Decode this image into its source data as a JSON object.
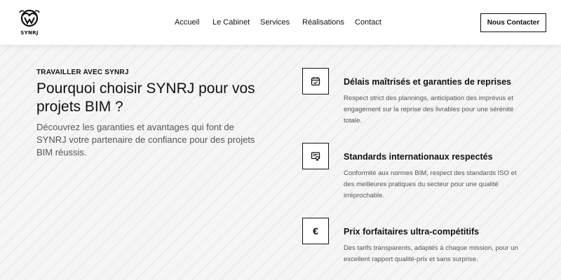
{
  "header": {
    "logo_text": "SYNRJ",
    "nav": [
      "Accueil",
      "Le Cabinet",
      "Services",
      "Réalisations",
      "Contact"
    ],
    "cta_label": "Nous Contacter"
  },
  "hero": {
    "eyebrow": "TRAVAILLER AVEC SYNRJ",
    "title": "Pourquoi choisir SYNRJ pour vos projets BIM ?",
    "subtitle": "Découvrez les garanties et avantages qui font de SYNRJ votre partenaire de confiance pour des projets BIM réussis."
  },
  "features": [
    {
      "icon": "calendar-check-icon",
      "title": "Délais maîtrisés et garanties de reprises",
      "text": "Respect strict des plannings, anticipation des imprévus et engagement sur la reprise des livrables pour une sérénité totale."
    },
    {
      "icon": "certificate-icon",
      "title": "Standards internationaux respectés",
      "text": "Conformité aux normes BIM, respect des standards ISO et des meilleures pratiques du secteur pour une qualité irréprochable."
    },
    {
      "icon": "euro-icon",
      "title": "Prix forfaitaires ultra-compétitifs",
      "text": "Des tarifs transparents, adaptés à chaque mission, pour un excellent rapport qualité-prix et sans surprise.",
      "glyph": "€"
    }
  ]
}
